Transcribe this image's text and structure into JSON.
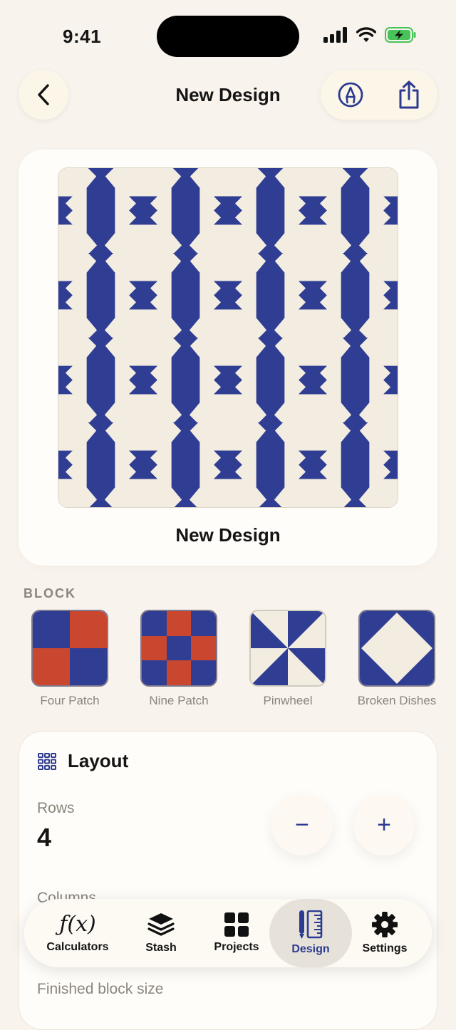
{
  "status_bar": {
    "time": "9:41"
  },
  "header": {
    "title": "New Design"
  },
  "preview": {
    "name": "New Design"
  },
  "blocks": {
    "section_label": "BLOCK",
    "items": [
      {
        "label": "Four Patch",
        "icon": "four-patch"
      },
      {
        "label": "Nine Patch",
        "icon": "nine-patch"
      },
      {
        "label": "Pinwheel",
        "icon": "pinwheel"
      },
      {
        "label": "Broken Dishes",
        "icon": "broken-dishes"
      }
    ]
  },
  "layout": {
    "title": "Layout",
    "rows_label": "Rows",
    "rows_value": "4",
    "columns_label": "Columns",
    "finished_block_size_label": "Finished block size",
    "minus_symbol": "−",
    "plus_symbol": "+"
  },
  "tabbar": {
    "items": [
      {
        "label": "Calculators",
        "icon": "function-icon"
      },
      {
        "label": "Stash",
        "icon": "stack-icon"
      },
      {
        "label": "Projects",
        "icon": "grid-icon"
      },
      {
        "label": "Design",
        "icon": "ruler-icon",
        "active": true
      },
      {
        "label": "Settings",
        "icon": "gear-icon"
      }
    ],
    "calculators_glyph": "ƒ(x)"
  },
  "colors": {
    "background": "#f8f3ec",
    "quilt_blue": "#2f3d93",
    "quilt_cream": "#f3ede1",
    "patch_red": "#c9472f",
    "accent": "#2c3b8f"
  }
}
